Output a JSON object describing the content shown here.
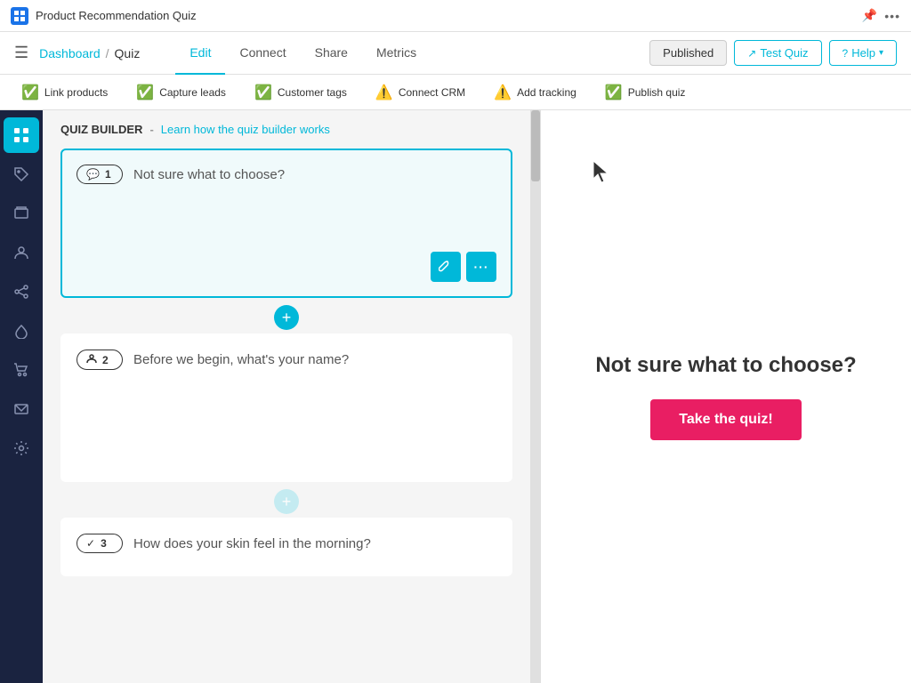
{
  "titlebar": {
    "app_name": "Product Recommendation Quiz",
    "pin_icon": "📌",
    "more_label": "•••"
  },
  "navbar": {
    "menu_icon": "☰",
    "breadcrumb": {
      "dashboard": "Dashboard",
      "separator": "/",
      "quiz": "Quiz"
    },
    "tabs": [
      {
        "id": "edit",
        "label": "Edit",
        "active": true
      },
      {
        "id": "connect",
        "label": "Connect",
        "active": false
      },
      {
        "id": "share",
        "label": "Share",
        "active": false
      },
      {
        "id": "metrics",
        "label": "Metrics",
        "active": false
      }
    ],
    "buttons": {
      "published": "Published",
      "test_quiz": "Test Quiz",
      "help": "Help"
    }
  },
  "statusbar": {
    "items": [
      {
        "id": "link-products",
        "label": "Link products",
        "status": "ok"
      },
      {
        "id": "capture-leads",
        "label": "Capture leads",
        "status": "ok"
      },
      {
        "id": "customer-tags",
        "label": "Customer tags",
        "status": "ok"
      },
      {
        "id": "connect-crm",
        "label": "Connect CRM",
        "status": "warn"
      },
      {
        "id": "add-tracking",
        "label": "Add tracking",
        "status": "warn"
      },
      {
        "id": "publish-quiz",
        "label": "Publish quiz",
        "status": "ok"
      }
    ]
  },
  "sidebar": {
    "items": [
      {
        "id": "grid",
        "icon": "⊞",
        "active": true
      },
      {
        "id": "tag",
        "icon": "🏷",
        "active": false
      },
      {
        "id": "layers",
        "icon": "⧉",
        "active": false
      },
      {
        "id": "user",
        "icon": "👤",
        "active": false
      },
      {
        "id": "share2",
        "icon": "⇄",
        "active": false
      },
      {
        "id": "drop",
        "icon": "💧",
        "active": false
      },
      {
        "id": "cart",
        "icon": "🛒",
        "active": false
      },
      {
        "id": "mail",
        "icon": "✉",
        "active": false
      },
      {
        "id": "gear",
        "icon": "⚙",
        "active": false
      }
    ]
  },
  "quizbuilder": {
    "title": "QUIZ BUILDER",
    "separator": "-",
    "help_link": "Learn how the quiz builder works",
    "questions": [
      {
        "id": 1,
        "badge_icon": "💬",
        "number": "1",
        "text": "Not sure what to choose?",
        "active": true,
        "actions": [
          {
            "id": "wrench",
            "icon": "🔧"
          },
          {
            "id": "more",
            "icon": "•••"
          }
        ]
      },
      {
        "id": 2,
        "badge_icon": "👤",
        "number": "2",
        "text": "Before we begin, what's your name?",
        "active": false,
        "actions": []
      },
      {
        "id": 3,
        "badge_icon": "✓",
        "number": "3",
        "text": "How does your skin feel in the morning?",
        "active": false,
        "actions": []
      }
    ],
    "add_btn_label": "+"
  },
  "preview": {
    "title": "Not sure what to choose?",
    "button_label": "Take the quiz!"
  }
}
